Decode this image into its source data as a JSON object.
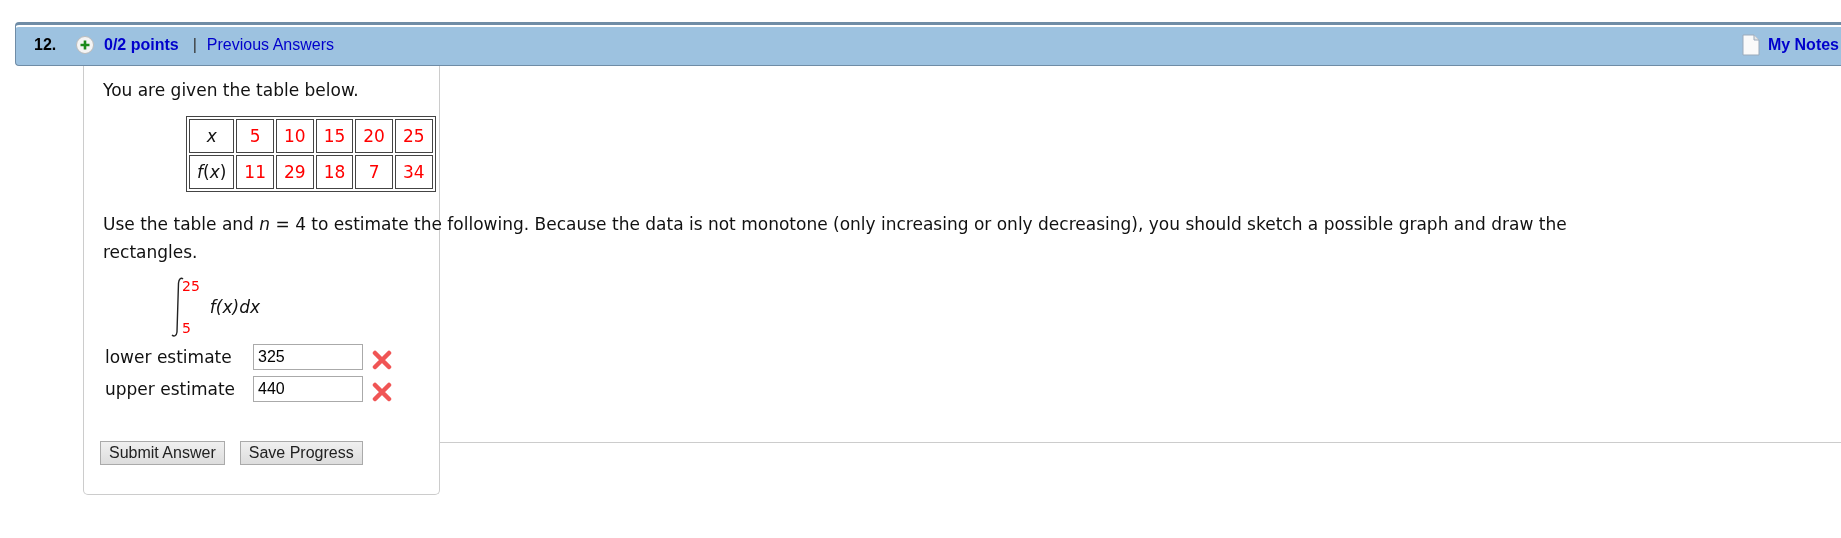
{
  "question": {
    "number": "12.",
    "points": "0/2 points",
    "separator": "|",
    "previous_answers": "Previous Answers",
    "my_notes": "My Notes"
  },
  "intro": "You are given the table below.",
  "table": {
    "rows": [
      {
        "header": "*x*",
        "values": [
          "5",
          "10",
          "15",
          "20",
          "25"
        ]
      },
      {
        "header": "*f*(*x*)",
        "values": [
          "11",
          "29",
          "18",
          "7",
          "34"
        ]
      }
    ]
  },
  "instruction": "Use the table and *n* = 4 to estimate the following. Because the data is not monotone (only increasing or only decreasing), you should sketch a possible graph and draw the rectangles.",
  "integral": {
    "upper": "25",
    "lower": "5",
    "integrand": "f(x)dx"
  },
  "answers": [
    {
      "label": "lower estimate",
      "value": "325",
      "correct": false
    },
    {
      "label": "upper estimate",
      "value": "440",
      "correct": false
    }
  ],
  "buttons": [
    "Submit Answer",
    "Save Progress"
  ]
}
